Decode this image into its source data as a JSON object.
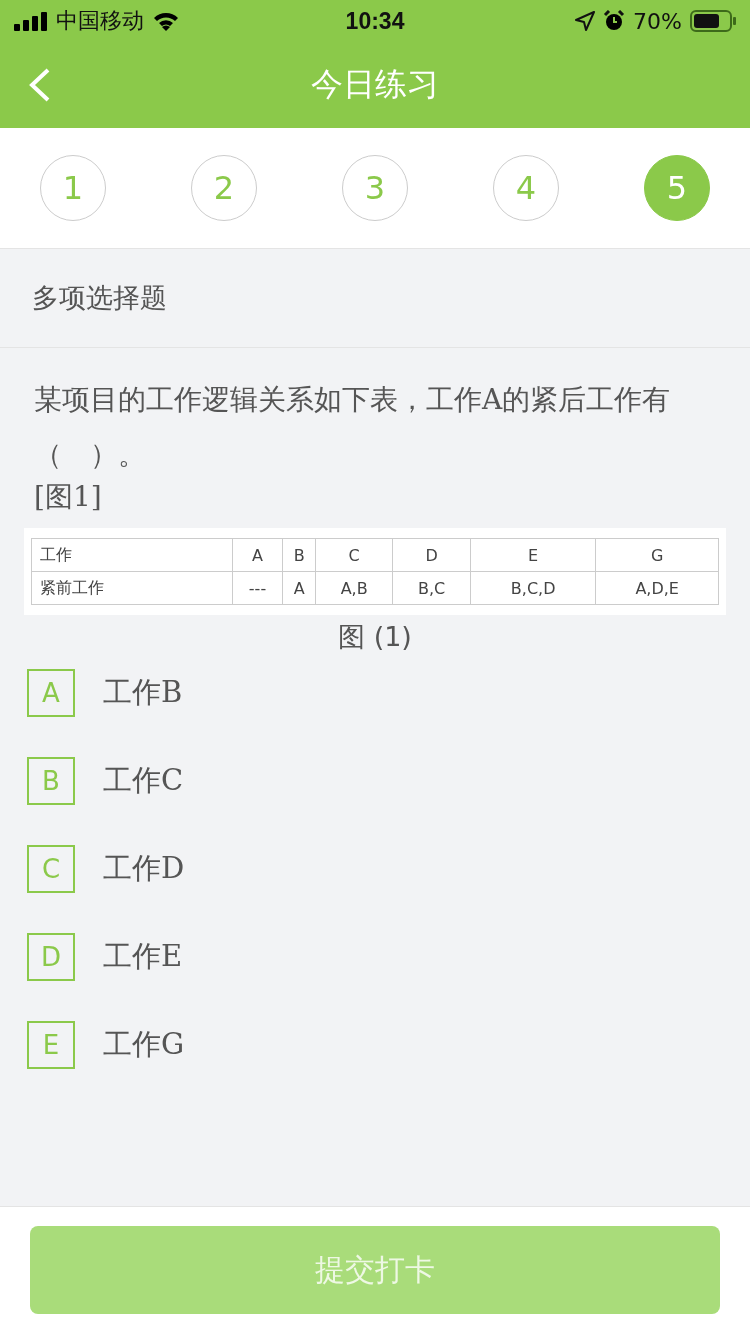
{
  "status_bar": {
    "carrier": "中国移动",
    "time": "10:34",
    "battery": "70%"
  },
  "nav": {
    "title": "今日练习"
  },
  "steps": [
    {
      "label": "1",
      "selected": false
    },
    {
      "label": "2",
      "selected": false
    },
    {
      "label": "3",
      "selected": false
    },
    {
      "label": "4",
      "selected": false
    },
    {
      "label": "5",
      "selected": true
    }
  ],
  "question_type": "多项选择题",
  "question": {
    "text": "某项目的工作逻辑关系如下表，工作A的紧后工作有（　）。",
    "figure_ref": "[图1]"
  },
  "table": {
    "rows": [
      [
        "工作",
        "A",
        "B",
        "C",
        "D",
        "E",
        "G"
      ],
      [
        "紧前工作",
        "---",
        "A",
        "A,B",
        "B,C",
        "B,C,D",
        "A,D,E"
      ]
    ],
    "caption": "图 (1)"
  },
  "options": [
    {
      "letter": "A",
      "text": "工作B",
      "selected": false
    },
    {
      "letter": "B",
      "text": "工作C",
      "selected": false
    },
    {
      "letter": "C",
      "text": "工作D",
      "selected": false
    },
    {
      "letter": "D",
      "text": "工作E",
      "selected": false
    },
    {
      "letter": "E",
      "text": "工作G",
      "selected": false
    }
  ],
  "submit": {
    "label": "提交打卡",
    "disabled": true
  }
}
